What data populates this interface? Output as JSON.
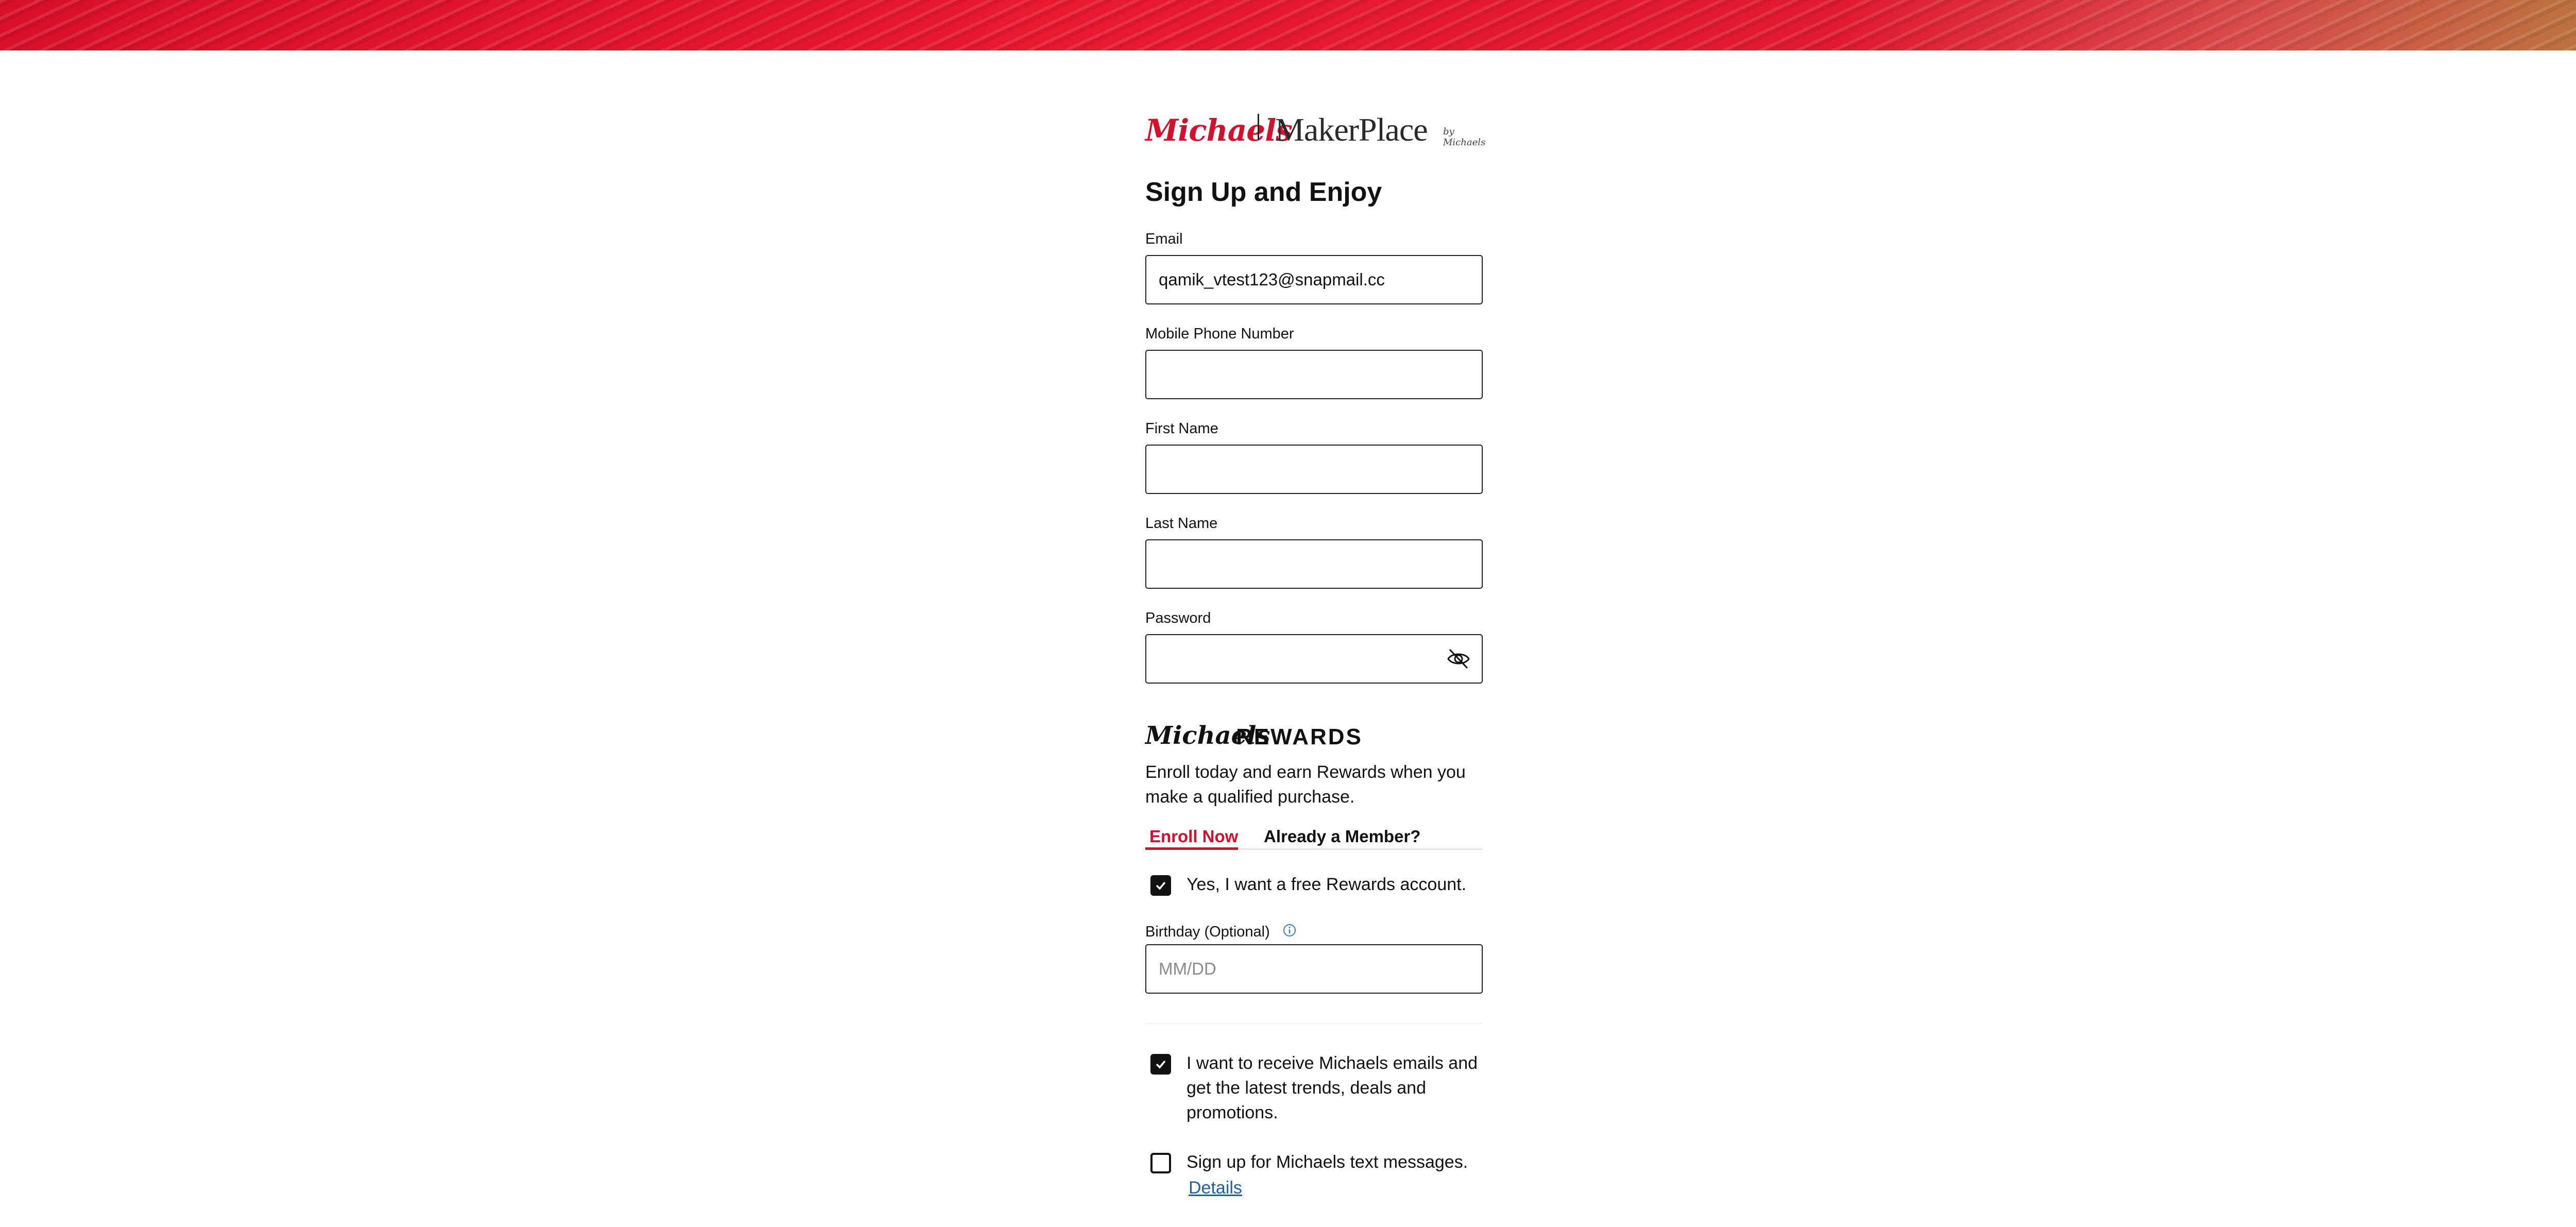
{
  "brand": {
    "michaels": "Michaels",
    "makerplace": "MakerPlace",
    "by_michaels": "by Michaels"
  },
  "page_title": "Sign Up and Enjoy",
  "fields": {
    "email": {
      "label": "Email",
      "value": "qamik_vtest123@snapmail.cc"
    },
    "phone": {
      "label": "Mobile Phone Number",
      "value": ""
    },
    "first_name": {
      "label": "First Name",
      "value": ""
    },
    "last_name": {
      "label": "Last Name",
      "value": ""
    },
    "password": {
      "label": "Password",
      "value": "",
      "toggle_icon": "eye-off-icon"
    }
  },
  "rewards": {
    "logo_michaels": "Michaels",
    "logo_rewards": "REWARDS",
    "description": "Enroll today and earn Rewards when you make a qualified purchase.",
    "tabs": [
      {
        "label": "Enroll Now",
        "active": true
      },
      {
        "label": "Already a Member?",
        "active": false
      }
    ],
    "free_account_checkbox": {
      "label": "Yes, I want a free Rewards account.",
      "checked": true
    },
    "birthday": {
      "label": "Birthday (Optional)",
      "placeholder": "MM/DD",
      "info_icon": "info-icon"
    }
  },
  "consents": {
    "emails": {
      "label": "I want to receive Michaels emails and get the latest trends, deals and promotions.",
      "checked": true
    },
    "texts": {
      "label": "Sign up for Michaels text messages.",
      "checked": false
    },
    "details_link": "Details"
  },
  "colors": {
    "brand_red": "#d4112c",
    "link_blue": "#1d5fab",
    "text": "#111111"
  }
}
